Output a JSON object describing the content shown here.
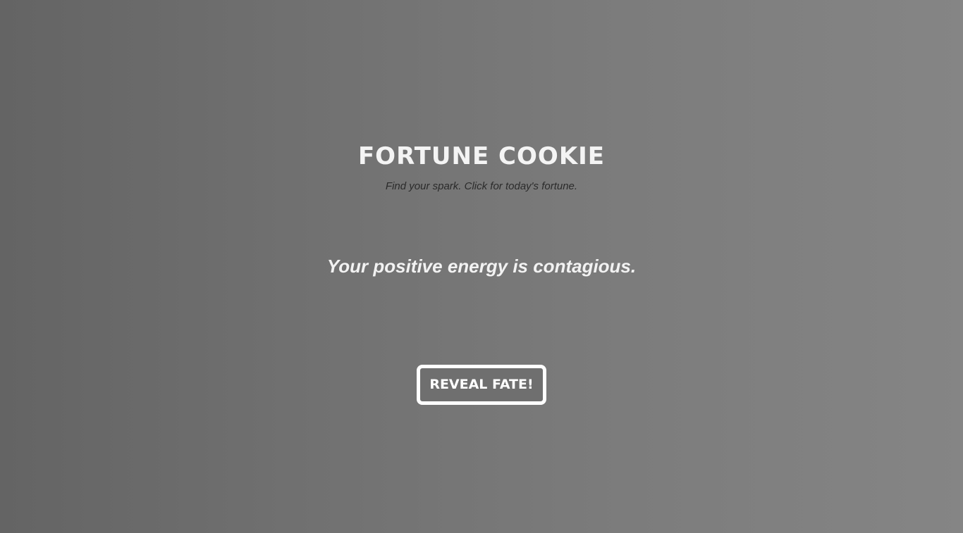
{
  "header": {
    "title": "FORTUNE COOKIE",
    "subtitle": "Find your spark. Click for today's fortune."
  },
  "main": {
    "fortune_text": "Your positive energy is contagious.",
    "reveal_button_label": "REVEAL FATE!"
  },
  "colors": {
    "background_left": "#646464",
    "background_right": "#858585",
    "title_text": "#f4f4f4",
    "subtitle_text": "#2b2b2b",
    "button_border": "#ffffff"
  }
}
